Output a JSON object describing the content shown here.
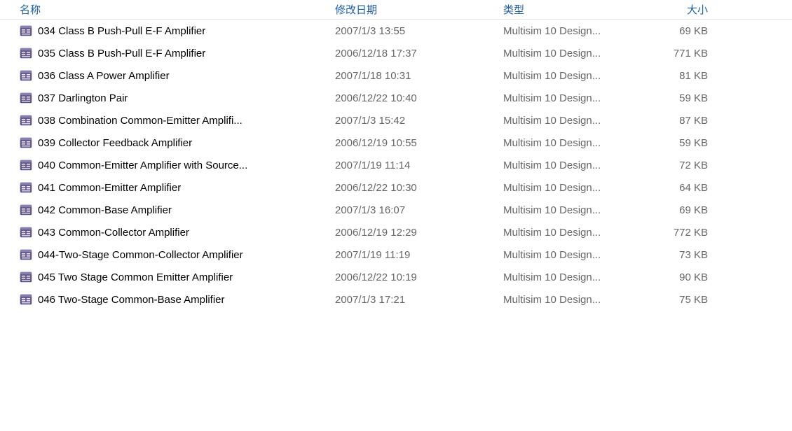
{
  "columns": {
    "name": "名称",
    "date": "修改日期",
    "type": "类型",
    "size": "大小"
  },
  "files": [
    {
      "name": "034 Class B Push-Pull E-F Amplifier",
      "date": "2007/1/3 13:55",
      "type": "Multisim 10 Design...",
      "size": "69 KB"
    },
    {
      "name": "035 Class B Push-Pull E-F Amplifier",
      "date": "2006/12/18 17:37",
      "type": "Multisim 10 Design...",
      "size": "771 KB"
    },
    {
      "name": "036 Class A Power Amplifier",
      "date": "2007/1/18 10:31",
      "type": "Multisim 10 Design...",
      "size": "81 KB"
    },
    {
      "name": "037 Darlington Pair",
      "date": "2006/12/22 10:40",
      "type": "Multisim 10 Design...",
      "size": "59 KB"
    },
    {
      "name": "038 Combination Common-Emitter Amplifi...",
      "date": "2007/1/3 15:42",
      "type": "Multisim 10 Design...",
      "size": "87 KB"
    },
    {
      "name": "039 Collector Feedback Amplifier",
      "date": "2006/12/19 10:55",
      "type": "Multisim 10 Design...",
      "size": "59 KB"
    },
    {
      "name": "040 Common-Emitter Amplifier with Source...",
      "date": "2007/1/19 11:14",
      "type": "Multisim 10 Design...",
      "size": "72 KB"
    },
    {
      "name": "041 Common-Emitter Amplifier",
      "date": "2006/12/22 10:30",
      "type": "Multisim 10 Design...",
      "size": "64 KB"
    },
    {
      "name": "042 Common-Base Amplifier",
      "date": "2007/1/3 16:07",
      "type": "Multisim 10 Design...",
      "size": "69 KB"
    },
    {
      "name": "043 Common-Collector Amplifier",
      "date": "2006/12/19 12:29",
      "type": "Multisim 10 Design...",
      "size": "772 KB"
    },
    {
      "name": "044-Two-Stage Common-Collector Amplifier",
      "date": "2007/1/19 11:19",
      "type": "Multisim 10 Design...",
      "size": "73 KB"
    },
    {
      "name": "045 Two Stage Common Emitter Amplifier",
      "date": "2006/12/22 10:19",
      "type": "Multisim 10 Design...",
      "size": "90 KB"
    },
    {
      "name": "046 Two-Stage Common-Base Amplifier",
      "date": "2007/1/3 17:21",
      "type": "Multisim 10 Design...",
      "size": "75 KB"
    }
  ]
}
